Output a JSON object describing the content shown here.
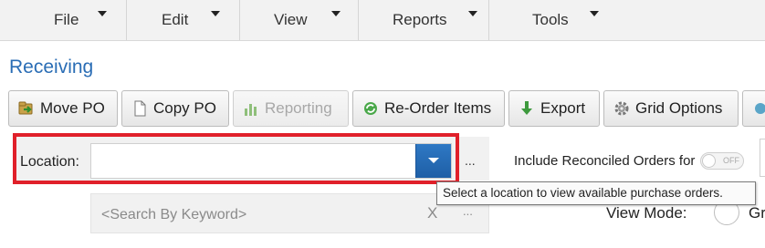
{
  "menubar": {
    "items": [
      {
        "label": "File"
      },
      {
        "label": "Edit"
      },
      {
        "label": "View"
      },
      {
        "label": "Reports"
      },
      {
        "label": "Tools"
      }
    ]
  },
  "page": {
    "title": "Receiving"
  },
  "toolbar": {
    "buttons": [
      {
        "label": "Move PO",
        "icon": "move-po-icon",
        "enabled": true
      },
      {
        "label": "Copy PO",
        "icon": "document-icon",
        "enabled": true
      },
      {
        "label": "Reporting",
        "icon": "bar-chart-icon",
        "enabled": false
      },
      {
        "label": "Re-Order Items",
        "icon": "recycle-icon",
        "enabled": true
      },
      {
        "label": "Export",
        "icon": "download-arrow-icon",
        "enabled": true
      },
      {
        "label": "Grid Options",
        "icon": "gear-icon",
        "enabled": true
      }
    ]
  },
  "location": {
    "label": "Location:",
    "value": "",
    "more": "..."
  },
  "reconciled": {
    "label": "Include Reconciled Orders for",
    "toggle_state": "OFF"
  },
  "tooltip": {
    "text": "Select a location to view available purchase orders."
  },
  "search": {
    "placeholder": "<Search By Keyword>",
    "clear": "X",
    "more": "..."
  },
  "view_mode": {
    "label": "View Mode:",
    "option_label": "Gr"
  },
  "colors": {
    "title": "#2a6db5",
    "highlight": "#e0202a",
    "dropdown": "#1e5fa6"
  }
}
